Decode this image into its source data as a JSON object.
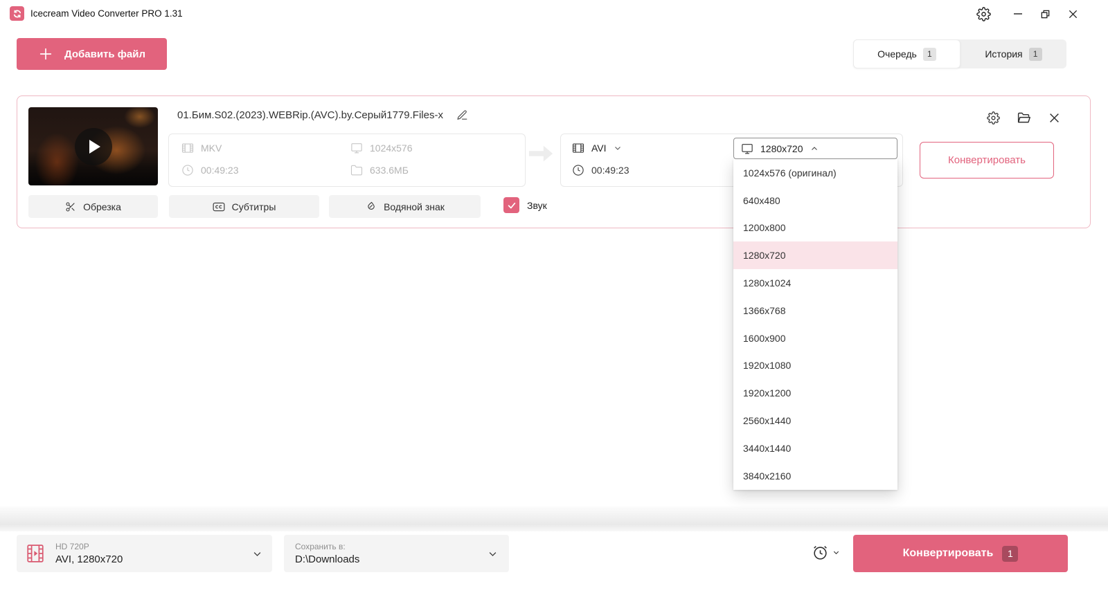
{
  "titlebar": {
    "app_title": "Icecream Video Converter PRO 1.31"
  },
  "header": {
    "add_file_label": "Добавить файл",
    "tabs": [
      {
        "label": "Очередь",
        "badge": "1"
      },
      {
        "label": "История",
        "badge": "1"
      }
    ]
  },
  "file_card": {
    "filename": "01.Бим.S02.(2023).WEBRip.(AVC).by.Серый1779.Files-x",
    "source": {
      "format": "MKV",
      "resolution": "1024x576",
      "duration": "00:49:23",
      "size": "633.6МБ"
    },
    "output": {
      "format": "AVI",
      "duration": "00:49:23",
      "selected_resolution": "1280x720"
    },
    "resolution_options": [
      "1024x576 (оригинал)",
      "640x480",
      "1200x800",
      "1280x720",
      "1280x1024",
      "1366x768",
      "1600x900",
      "1920x1080",
      "1920x1200",
      "2560x1440",
      "3440x1440",
      "3840x2160"
    ],
    "row_convert_label": "Конвертировать",
    "tools": [
      {
        "label": "Обрезка"
      },
      {
        "label": "Субтитры"
      },
      {
        "label": "Водяной знак"
      }
    ],
    "sound_label": "Звук",
    "sound_checked": true
  },
  "bottom_bar": {
    "preset": {
      "title": "HD 720P",
      "subtitle": "AVI, 1280x720"
    },
    "save_to": {
      "label": "Сохранить в:",
      "path": "D:\\Downloads"
    },
    "convert": {
      "label": "Конвертировать",
      "badge": "1"
    }
  },
  "colors": {
    "accent": "#e2637d",
    "accent_badge": "#a84a5e",
    "card_border": "#efb8c3",
    "selected_option_bg": "#fae3e8"
  }
}
